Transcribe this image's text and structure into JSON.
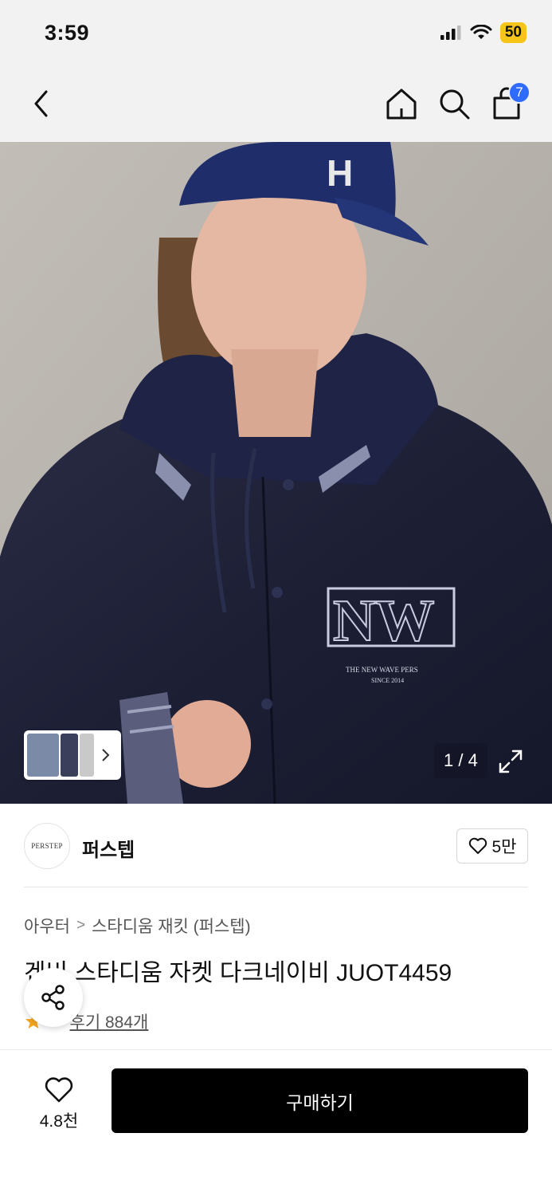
{
  "status_bar": {
    "time": "3:59",
    "battery": "50",
    "icons": [
      "cellular-signal-icon",
      "wifi-icon",
      "battery-icon"
    ]
  },
  "nav": {
    "back_icon": "chevron-left-icon",
    "home_icon": "home-icon",
    "search_icon": "search-icon",
    "cart_icon": "shopping-bag-icon",
    "cart_count": "7",
    "cart_badge_color": "#2f6bff"
  },
  "gallery": {
    "counter": "1 / 4",
    "expand_icon": "expand-icon",
    "thumb_next_icon": "chevron-right-icon"
  },
  "brand": {
    "logo_text": "PERSTEP",
    "name": "퍼스텝",
    "like_count": "5만",
    "like_icon": "heart-outline-icon"
  },
  "breadcrumb": {
    "category": "아우터",
    "subcategory": "스타디움 재킷 (퍼스텝)"
  },
  "product": {
    "title": "겐비 스타디움 자켓 다크네이비 JUOT4459",
    "rating_display": ".9",
    "review_label": "후기 884개",
    "star_color": "#f5a623"
  },
  "share": {
    "icon": "share-icon"
  },
  "bottom_bar": {
    "wish_count": "4.8천",
    "buy_label": "구매하기",
    "buy_color": "#000000"
  }
}
